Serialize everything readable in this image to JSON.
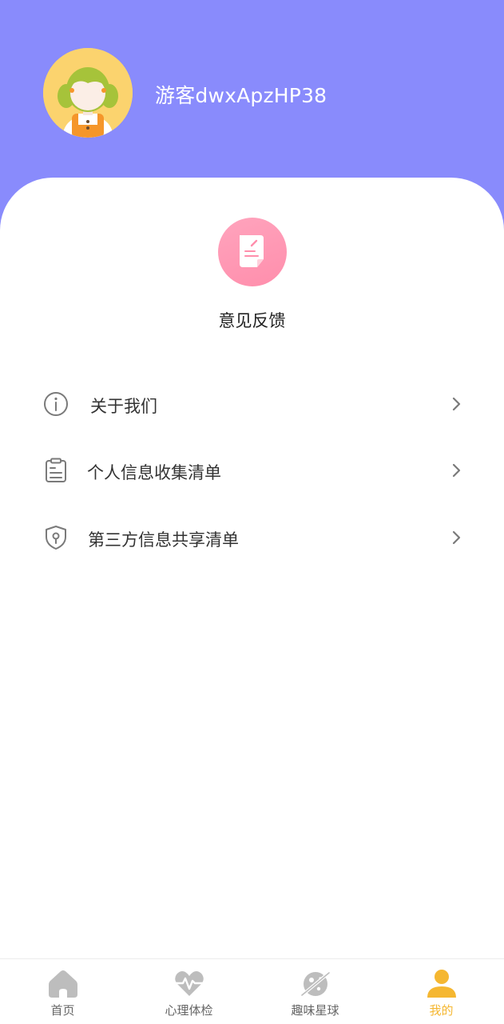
{
  "profile": {
    "username": "游客dwxApzHP38"
  },
  "feedback": {
    "label": "意见反馈"
  },
  "menu": {
    "items": [
      {
        "label": "关于我们",
        "icon": "info-icon"
      },
      {
        "label": "个人信息收集清单",
        "icon": "clipboard-icon"
      },
      {
        "label": "第三方信息共享清单",
        "icon": "shield-icon"
      }
    ]
  },
  "tabbar": {
    "tabs": [
      {
        "label": "首页",
        "icon": "home-icon",
        "active": false
      },
      {
        "label": "心理体检",
        "icon": "heart-pulse-icon",
        "active": false
      },
      {
        "label": "趣味星球",
        "icon": "planet-icon",
        "active": false
      },
      {
        "label": "我的",
        "icon": "user-icon",
        "active": true
      }
    ]
  },
  "colors": {
    "header_bg": "#898bfc",
    "feedback_pink": "#ff8eac",
    "tab_active": "#f5b731",
    "tab_inactive": "#bdbdbd"
  }
}
